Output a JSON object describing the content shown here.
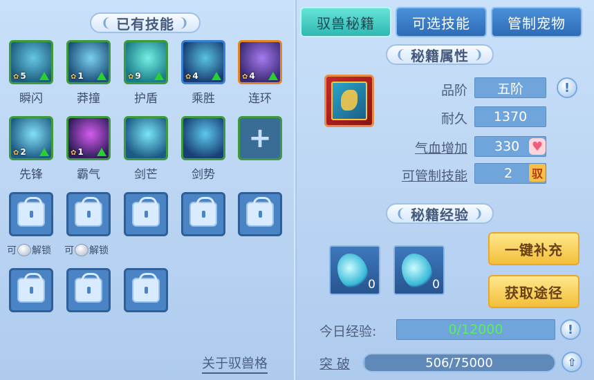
{
  "left_panel": {
    "title": "已有技能",
    "skills": [
      {
        "name": "瞬闪",
        "level": "5",
        "upgradeable": true,
        "frame": "green",
        "art": [
          "#1d5e7d",
          "#67c6e6"
        ]
      },
      {
        "name": "莽撞",
        "level": "1",
        "upgradeable": true,
        "frame": "green",
        "art": [
          "#1c4f7a",
          "#7ad0f0"
        ]
      },
      {
        "name": "护盾",
        "level": "9",
        "upgradeable": true,
        "frame": "green",
        "art": [
          "#1b7c8a",
          "#74efe2"
        ]
      },
      {
        "name": "乘胜",
        "level": "4",
        "upgradeable": true,
        "frame": "blue",
        "art": [
          "#173c74",
          "#58c4e0"
        ]
      },
      {
        "name": "连环",
        "level": "4",
        "upgradeable": true,
        "frame": "orange",
        "art": [
          "#392a74",
          "#a67af0"
        ]
      },
      {
        "name": "先锋",
        "level": "2",
        "upgradeable": true,
        "frame": "green",
        "art": [
          "#1d5c86",
          "#84e0f6"
        ]
      },
      {
        "name": "霸气",
        "level": "1",
        "upgradeable": true,
        "frame": "green",
        "art": [
          "#2e1c5a",
          "#d45cf0"
        ]
      },
      {
        "name": "剑芒",
        "level": "",
        "upgradeable": false,
        "frame": "green",
        "art": [
          "#1c5a86",
          "#7ae6f6"
        ]
      },
      {
        "name": "剑势",
        "level": "",
        "upgradeable": false,
        "frame": "green",
        "art": [
          "#183f76",
          "#5cc8ec"
        ]
      }
    ],
    "unlock_text": "解锁",
    "unlock_prefix": "可",
    "about_link": "关于驭兽格"
  },
  "tabs": [
    {
      "label": "驭兽秘籍",
      "active": true
    },
    {
      "label": "可选技能",
      "active": false
    },
    {
      "label": "管制宠物",
      "active": false
    }
  ],
  "attributes": {
    "title": "秘籍属性",
    "grade_label": "品阶",
    "grade_value": "五阶",
    "durability_label": "耐久",
    "durability_value": "1370",
    "hp_label": "气血增加",
    "hp_value": "330",
    "controllable_label": "可管制技能",
    "controllable_value": "2",
    "yu_glyph": "驭",
    "heart_glyph": "♥"
  },
  "experience": {
    "title": "秘籍经验",
    "items": [
      {
        "count": "0"
      },
      {
        "count": "0"
      }
    ],
    "refill_button": "一键补充",
    "obtain_button": "获取途径",
    "today_label": "今日经验:",
    "today_value": "0/12000",
    "break_label": "突 破",
    "break_value": "506/75000",
    "break_progress": 0.0067
  },
  "help_glyph": "!",
  "up_glyph": "⇧",
  "plus_glyph": "+"
}
